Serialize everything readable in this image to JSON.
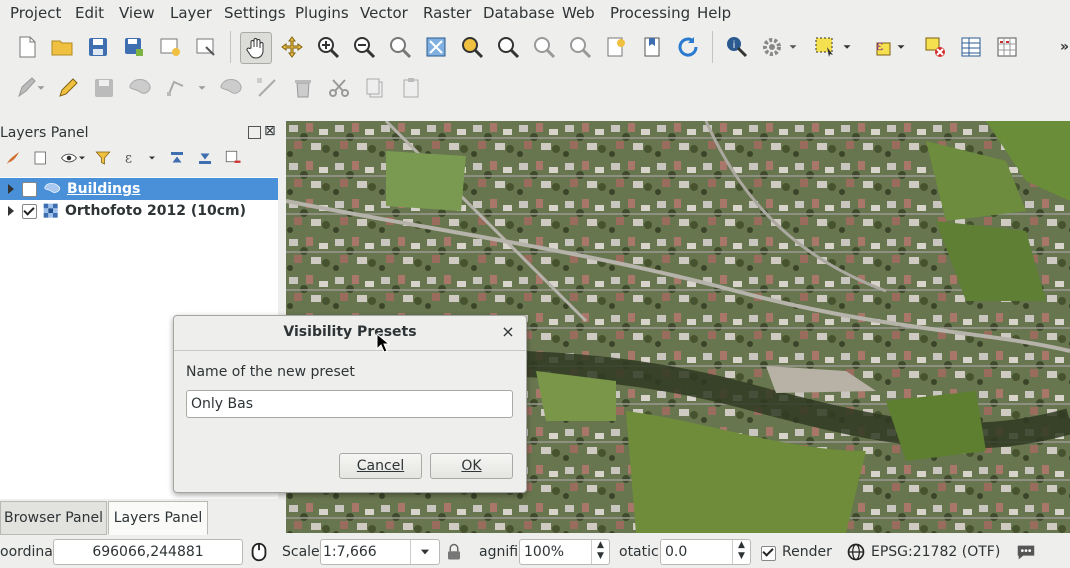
{
  "menu": [
    "Project",
    "Edit",
    "View",
    "Layer",
    "Settings",
    "Plugins",
    "Vector",
    "Raster",
    "Database",
    "Web",
    "Processing",
    "Help"
  ],
  "toolbar": {
    "overflow": "»"
  },
  "layers_panel": {
    "title": "Layers Panel",
    "layers": [
      {
        "name": "Buildings",
        "checked": false,
        "selected": true
      },
      {
        "name": "Orthofoto 2012 (10cm)",
        "checked": true,
        "selected": false
      }
    ]
  },
  "bottom_tabs": [
    "Browser Panel",
    "Layers Panel"
  ],
  "status": {
    "coord_label": "oordina",
    "coordinate": "696066,244881",
    "scale_label": "Scale",
    "scale": "1:7,666",
    "magnifier_label": "agnifi",
    "magnifier": "100%",
    "rotation_label": "otatic",
    "rotation": "0.0",
    "render_label": "Render",
    "crs": "EPSG:21782 (OTF)"
  },
  "dialog": {
    "title": "Visibility Presets",
    "close": "×",
    "label": "Name of the new preset",
    "input_value": "Only Bas",
    "cancel": "Cancel",
    "ok": "OK"
  },
  "colors": {
    "selection": "#4a90d9",
    "window_bg": "#eeeeec"
  }
}
